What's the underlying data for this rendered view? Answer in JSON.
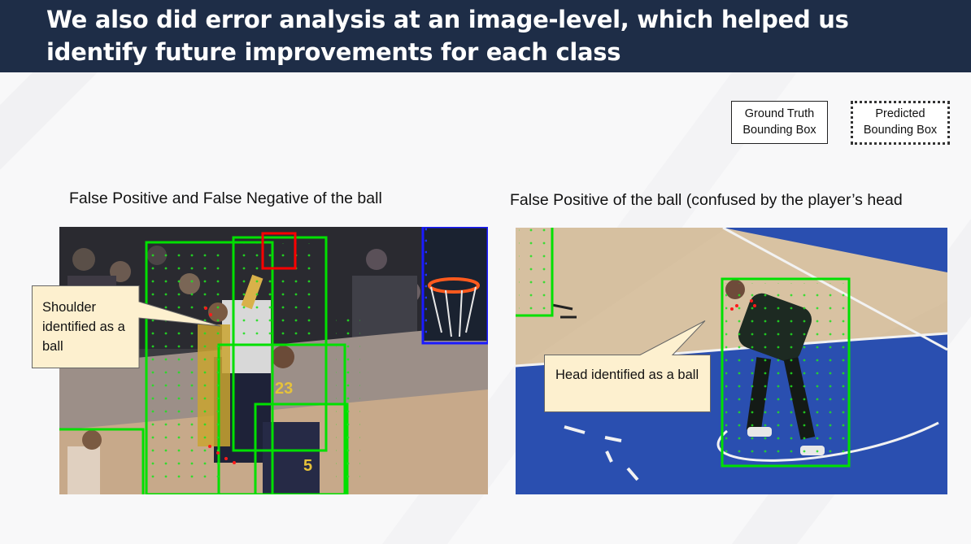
{
  "header": {
    "title": "We also did error analysis at an image-level, which helped us identify future improvements for each class"
  },
  "legend": {
    "ground_truth": "Ground Truth Bounding Box",
    "predicted": "Predicted Bounding Box"
  },
  "panels": {
    "left": {
      "caption": "False Positive and False Negative of the ball",
      "callout": "Shoulder identified as a ball"
    },
    "right": {
      "caption": "False Positive of the ball (confused by the player’s head",
      "callout": "Head identified as a ball"
    }
  },
  "colors": {
    "header_bg": "#1e2d47",
    "ground_truth_box": "#00e000",
    "predicted_box": "#ff0000",
    "callout_fill": "#fdf0cf",
    "court_blue": "#2a4fb0",
    "court_wood": "#d6c0a0"
  }
}
